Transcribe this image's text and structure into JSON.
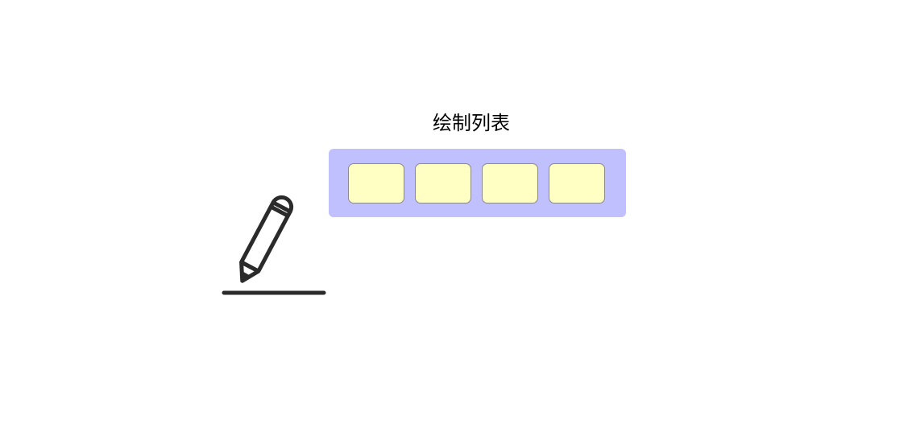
{
  "diagram": {
    "title": "绘制列表",
    "list_cell_count": 4,
    "colors": {
      "list_background": "#c0c0ff",
      "cell_fill": "#ffffc4",
      "cell_border": "#8a8a8a",
      "icon_stroke": "#2b2b2b"
    },
    "icon": "pencil-icon"
  }
}
